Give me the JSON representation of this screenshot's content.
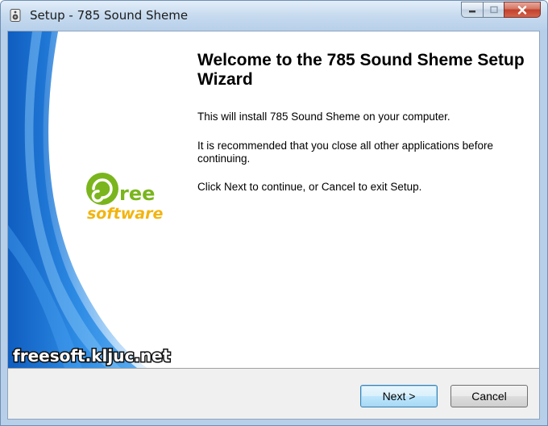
{
  "window": {
    "title": "Setup - 785 Sound Sheme"
  },
  "caption_buttons": {
    "minimize": "minimize-icon",
    "maximize": "maximize-icon",
    "close": "close-icon"
  },
  "sidebar": {
    "logo_top": "ree",
    "logo_bottom": "software",
    "watermark": "freesoft.kljuc.net"
  },
  "main": {
    "heading": "Welcome to the 785 Sound Sheme Setup Wizard",
    "paragraphs": [
      "This will install 785 Sound Sheme on your computer.",
      "It is recommended that you close all other applications before continuing.",
      "Click Next to continue, or Cancel to exit Setup."
    ]
  },
  "buttons": {
    "next": "Next >",
    "cancel": "Cancel"
  },
  "colors": {
    "sidebar_blue": "#1e7ad6",
    "logo_green": "#7ab51d",
    "logo_yellow": "#f2b410"
  }
}
